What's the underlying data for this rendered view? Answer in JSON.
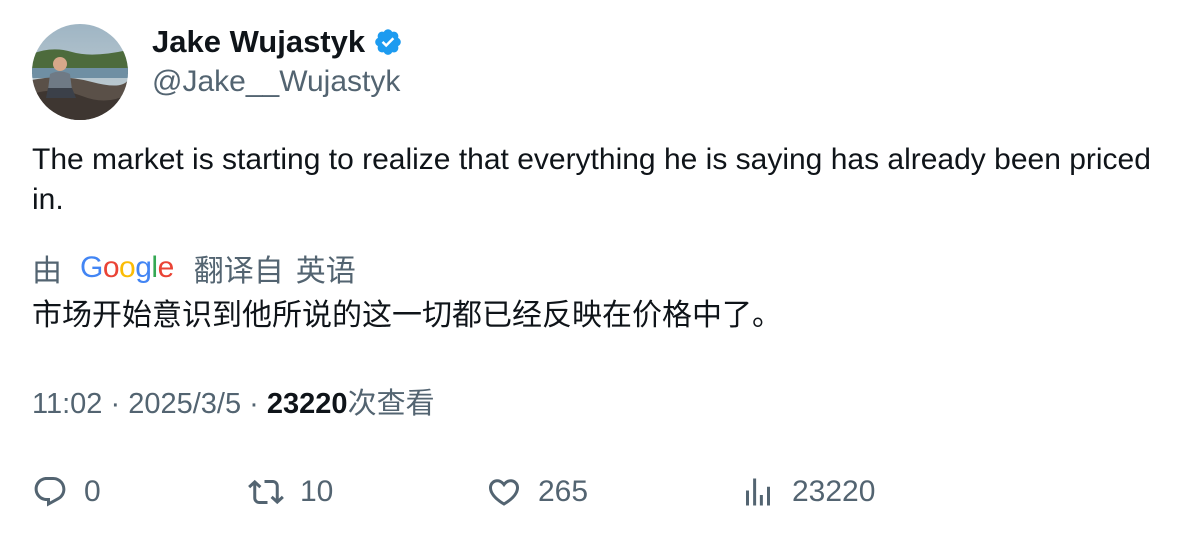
{
  "author": {
    "display_name": "Jake Wujastyk",
    "handle": "@Jake__Wujastyk",
    "verified": true,
    "avatar_icon": "profile-photo"
  },
  "tweet": {
    "text": "The market is starting to realize that everything he is saying has already been priced in."
  },
  "translation": {
    "by_label": "由",
    "provider": "Google",
    "translated_from_label": "翻译自",
    "source_language": "英语",
    "text": "市场开始意识到他所说的这一切都已经反映在价格中了。"
  },
  "meta": {
    "time": "11:02",
    "separator1": "·",
    "date": "2025/3/5",
    "separator2": "·",
    "views_count": "23220",
    "views_label": "次查看"
  },
  "actions": {
    "reply": {
      "icon": "reply-icon",
      "count": "0"
    },
    "retweet": {
      "icon": "retweet-icon",
      "count": "10"
    },
    "like": {
      "icon": "heart-icon",
      "count": "265"
    },
    "views": {
      "icon": "analytics-icon",
      "count": "23220"
    }
  },
  "colors": {
    "text_primary": "#0f1419",
    "text_secondary": "#536471",
    "verified_blue": "#1d9bf0"
  }
}
